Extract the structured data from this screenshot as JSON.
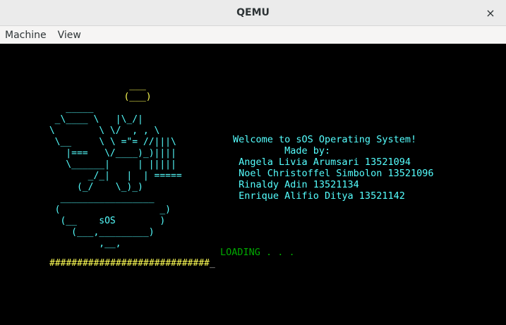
{
  "window": {
    "title": "QEMU",
    "close_glyph": "×"
  },
  "menu": {
    "items": [
      "Machine",
      "View"
    ]
  },
  "screen": {
    "halo_art": "    ___\n   (___)",
    "mascot_art": "\n\n    _____\n  _\\____ \\   |\\_/|\n \\        \\ \\/  , , \\\n  \\__     \\ \\ =\"= //|||\\\n    |===   \\/____)_)||||\n    \\______|     | |||||\n        _/_|   |  | =====\n      (_/    \\_)_)\n   _________________\n  (                  _)\n   (__    sOS        )\n     (___,_________)\n          ,__,",
    "welcome_lines": [
      "Welcome to sOS Operating System!",
      "         Made by:",
      " Angela Livia Arumsari 13521094",
      " Noel Christoffel Simbolon 13521096",
      " Rinaldy Adin 13521134",
      " Enrique Alifio Ditya 13521142"
    ],
    "loading_text": "LOADING . . .",
    "progress_bar": "#############################",
    "cursor": "_"
  },
  "colors": {
    "art_cyan": "#55ffff",
    "halo_yellow": "#ffff55",
    "loading_green": "#00aa00",
    "screen_bg": "#000000"
  }
}
